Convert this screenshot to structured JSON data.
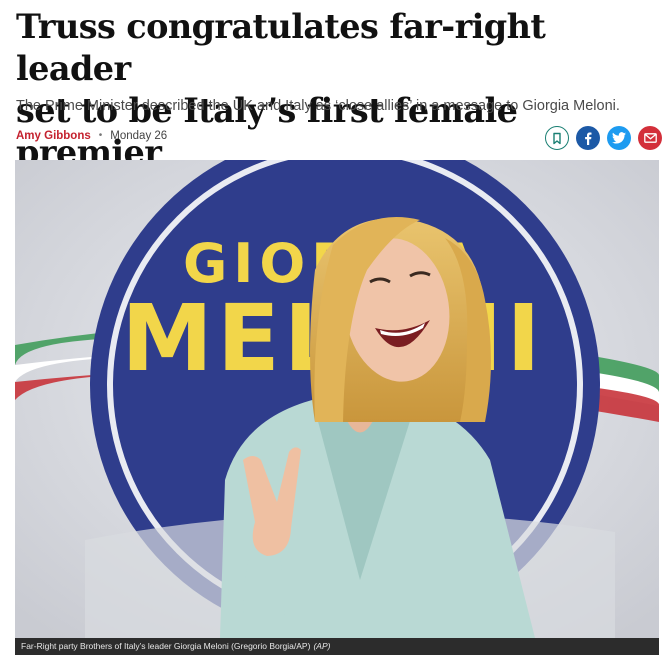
{
  "article": {
    "headline_line1": "Truss congratulates far-right leader",
    "headline_line2": "set to be Italy’s first female premier",
    "standfirst": "The Prime Minister described the UK and Italy as ‘close allies’ in a message to Giorgia Meloni.",
    "author": "Amy Gibbons",
    "separator": "•",
    "date": "Monday 26"
  },
  "share": {
    "icons": [
      "bookmark-icon",
      "facebook-icon",
      "twitter-icon",
      "email-icon"
    ]
  },
  "photo": {
    "logo_line1": "GIORGIA",
    "logo_line2": "MELONI",
    "caption": "Far-Right party Brothers of Italy’s leader Giorgia Meloni (Gregorio Borgia/AP)",
    "credit": "(AP)"
  },
  "colors": {
    "author": "#c4212e",
    "bookmark": "#1a7f73",
    "facebook": "#1c59a6",
    "twitter": "#1d9bf0",
    "email": "#d32f3a",
    "logo_blue": "#2f3d8c",
    "logo_yellow": "#f2d64a"
  }
}
